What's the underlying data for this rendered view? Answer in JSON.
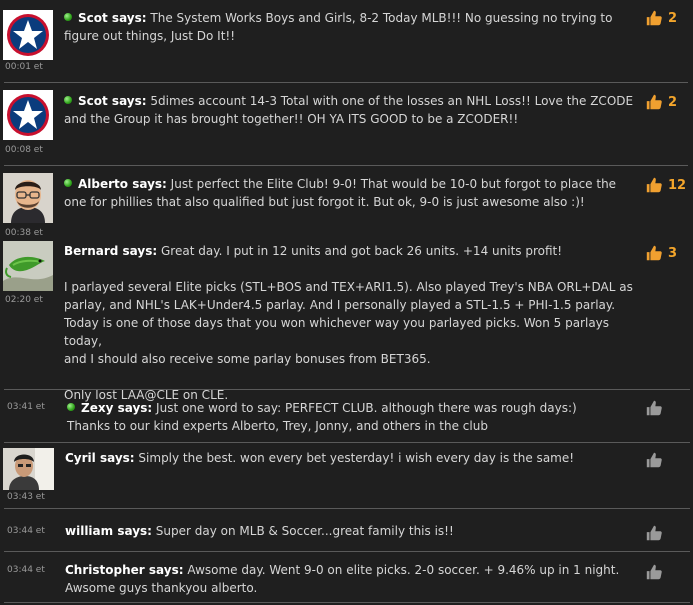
{
  "posts": [
    {
      "author": "Scot",
      "says": " says:",
      "online": true,
      "time": "00:01 et",
      "lines": [
        "The System Works Boys and Girls, 8-2 Today MLB!!! No guessing no trying to",
        "figure out things, Just Do It!!"
      ],
      "likes": "2",
      "like_active": true,
      "avatar_icon": "star-logo-icon"
    },
    {
      "author": "Scot",
      "says": " says:",
      "online": true,
      "time": "00:08 et",
      "lines": [
        "5dimes account 14-3 Total with one of the losses an NHL Loss!! Love the ZCODE",
        "and the Group it has brought together!! OH YA ITS GOOD to be a ZCODER!!"
      ],
      "likes": "2",
      "like_active": true,
      "avatar_icon": "star-logo-icon"
    },
    {
      "author": "Alberto",
      "says": " says:",
      "online": true,
      "time": "00:38 et",
      "lines": [
        "Just perfect the Elite Club! 9-0! That would be 10-0 but forgot to place the",
        "one for phillies that also qualified but just forgot it. But ok, 9-0 is just awesome also :)!"
      ],
      "likes": "12",
      "like_active": true,
      "avatar_icon": "man-portrait-icon"
    },
    {
      "author": "Bernard",
      "says": " says:",
      "online": false,
      "time": "02:20 et",
      "lines": [
        "Great day. I put in 12 units and got back 26 units. +14 units profit!",
        "",
        "I parlayed several Elite picks (STL+BOS and TEX+ARI1.5). Also played Trey's NBA ORL+DAL as",
        "parlay, and NHL's LAK+Under4.5 parlay. And I personally played a STL-1.5 + PHI-1.5 parlay.",
        "Today is one of those days that you won whichever way you parlayed picks. Won 5 parlays today,",
        "and I should also receive some parlay bonuses from BET365.",
        "",
        "Only lost LAA@CLE on CLE."
      ],
      "likes": "3",
      "like_active": true,
      "avatar_icon": "lizard-photo-icon"
    },
    {
      "author": "Zexy",
      "says": " says:",
      "online": true,
      "time": "03:41 et",
      "lines": [
        "Just one word to say: PERFECT CLUB. although there was rough days:)",
        "Thanks to our kind experts Alberto, Trey, Jonny, and others in the club"
      ],
      "likes": "",
      "like_active": false,
      "avatar_icon": ""
    },
    {
      "author": "Cyril",
      "says": " says:",
      "online": false,
      "time": "03:43 et",
      "lines": [
        "Simply the best. won every bet yesterday! i wish every day is the same!"
      ],
      "likes": "",
      "like_active": false,
      "avatar_icon": "person-photo-icon"
    },
    {
      "author": "william",
      "says": " says:",
      "online": false,
      "time": "03:44 et",
      "lines": [
        "Super day on MLB & Soccer...great family this is!!"
      ],
      "likes": "",
      "like_active": false,
      "avatar_icon": ""
    },
    {
      "author": "Christopher",
      "says": " says:",
      "online": false,
      "time": "03:44 et",
      "lines": [
        "Awsome day. Went 9-0 on elite picks. 2-0 soccer. + 9.46% up in 1 night.",
        "Awsome guys thankyou alberto."
      ],
      "likes": "",
      "like_active": false,
      "avatar_icon": ""
    }
  ],
  "colors": {
    "background": "#1f1f1f",
    "separator": "#5a5a5a",
    "name": "#ffffff",
    "text": "#d6d6d6",
    "time": "#9a9a9a",
    "like_count": "#f3a52b",
    "thumb_active": "#f0a030",
    "thumb_inactive": "#9a9a9a",
    "online_dot": "#2fa31a"
  }
}
